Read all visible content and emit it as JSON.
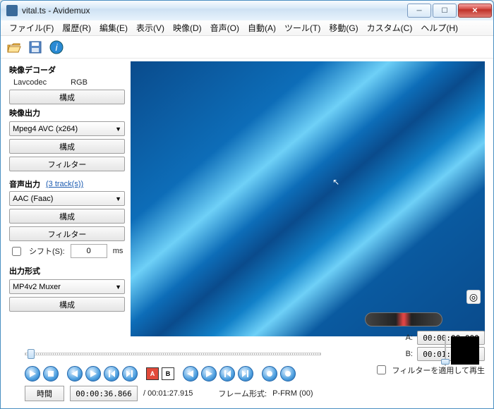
{
  "window": {
    "title": "vital.ts - Avidemux"
  },
  "menu": [
    "ファイル(F)",
    "履歴(R)",
    "編集(E)",
    "表示(V)",
    "映像(D)",
    "音声(O)",
    "自動(A)",
    "ツール(T)",
    "移動(G)",
    "カスタム(C)",
    "ヘルプ(H)"
  ],
  "toolbar_icons": [
    "open-icon",
    "save-icon",
    "info-icon"
  ],
  "decoder": {
    "title": "映像デコーダ",
    "codec": "Lavcodec",
    "colorspace": "RGB",
    "configure": "構成"
  },
  "video_out": {
    "title": "映像出力",
    "selected": "Mpeg4 AVC (x264)",
    "configure": "構成",
    "filters": "フィルター"
  },
  "audio_out": {
    "title": "音声出力",
    "tracks": "(3 track(s))",
    "selected": "AAC (Faac)",
    "configure": "構成",
    "filters": "フィルター",
    "shift_label": "シフト(S):",
    "shift_value": "0",
    "shift_unit": "ms"
  },
  "output_fmt": {
    "title": "出力形式",
    "selected": "MP4v2 Muxer",
    "configure": "構成"
  },
  "marker_a": "A",
  "marker_b": "B",
  "ab": {
    "a_label": "A:",
    "a_time": "00:00:00.000",
    "b_label": "B:",
    "b_time": "00:01:27.915"
  },
  "filter_apply": "フィルターを適用して再生",
  "timebar": {
    "time_btn": "時間",
    "current": "00:00:36.866",
    "total": "/ 00:01:27.915",
    "frame_label": "フレーム形式:",
    "frame_value": "P-FRM (00)"
  }
}
